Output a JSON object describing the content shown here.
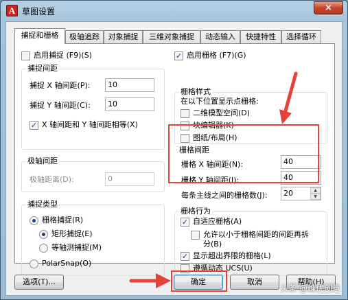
{
  "window": {
    "title": "草图设置",
    "app_icon_letter": "A",
    "close_label": "×"
  },
  "tabs": [
    {
      "label": "捕捉和栅格",
      "active": true
    },
    {
      "label": "极轴追踪"
    },
    {
      "label": "对象捕捉"
    },
    {
      "label": "三维对象捕捉"
    },
    {
      "label": "动态输入"
    },
    {
      "label": "快捷特性"
    },
    {
      "label": "选择循环"
    }
  ],
  "snap": {
    "enable_label": "启用捕捉 (F9)(S)",
    "enable_checked": false,
    "spacing_group": "捕捉间距",
    "x_label": "捕捉 X 轴间距(P):",
    "x_value": "10",
    "y_label": "捕捉 Y 轴间距(C):",
    "y_value": "10",
    "equal_label": "X 轴间距和 Y 轴间距相等(X)",
    "equal_checked": true
  },
  "polar": {
    "group": "极轴间距",
    "distance_label": "极轴距离(D):",
    "distance_value": "0"
  },
  "snap_type": {
    "group": "捕捉类型",
    "grid_snap_label": "栅格捕捉(R)",
    "rect_snap_label": "矩形捕捉(E)",
    "iso_snap_label": "等轴测捕捉(M)",
    "polar_snap_label": "PolarSnap(O)"
  },
  "grid": {
    "enable_label": "启用栅格 (F7)(G)",
    "enable_checked": true,
    "style_group": "栅格样式",
    "style_caption": "在以下位置显示点栅格:",
    "model_space_label": "二维模型空间(D)",
    "block_editor_label": "块编辑器(K)",
    "sheet_layout_label": "图纸/布局(H)",
    "spacing_group": "栅格间距",
    "x_label": "栅格 X 轴间距(N):",
    "x_value": "40",
    "y_label": "栅格 Y 轴间距(I):",
    "y_value": "40",
    "major_label": "每条主线之间的栅格数(J):",
    "major_value": "20",
    "behavior_group": "栅格行为",
    "adaptive_label": "自适应栅格(A)",
    "adaptive_checked": true,
    "subdivide_label_1": "允许以小于栅格间距的间距再拆",
    "subdivide_label_2": "分(B)",
    "beyond_label": "显示超出界限的栅格(L)",
    "beyond_checked": true,
    "follow_ucs_label": "遵循动态 UCS(U)"
  },
  "buttons": {
    "options": "选项(T)...",
    "ok": "确定",
    "cancel": "取消",
    "help": "帮助(H)"
  },
  "watermark": "头条 @维优创意",
  "colors": {
    "annotation_red": "#e8413a",
    "check_blue": "#1b3c8a"
  }
}
